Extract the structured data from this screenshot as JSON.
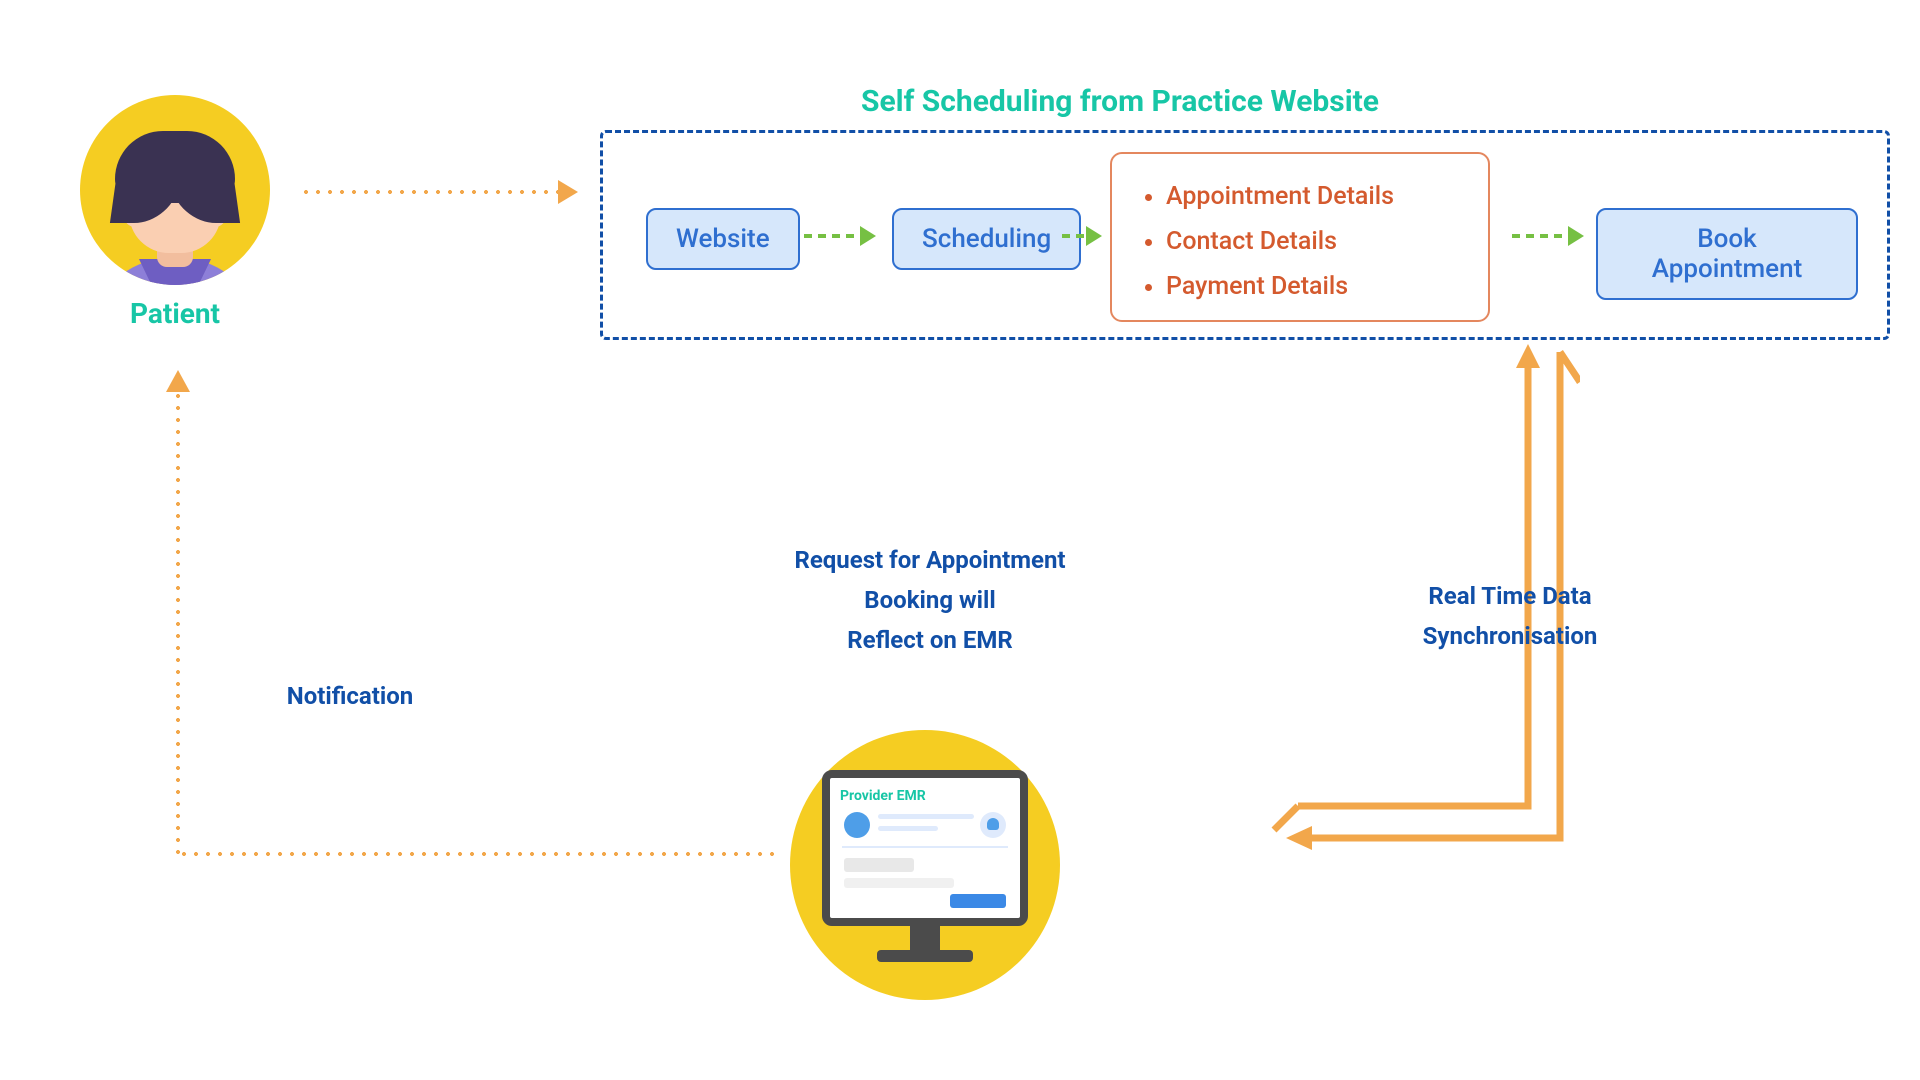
{
  "diagram": {
    "patient_label": "Patient",
    "container_title": "Self Scheduling from Practice Website",
    "nodes": {
      "website": "Website",
      "scheduling": "Scheduling",
      "book_appointment": "Book Appointment"
    },
    "details": {
      "item1": "Appointment Details",
      "item2": "Contact Details",
      "item3": "Payment Details"
    },
    "emr": {
      "badge": "Provider EMR",
      "request_line1": "Request for Appointment",
      "request_line2": "Booking will",
      "request_line3": "Reflect on EMR"
    },
    "sync_line1": "Real Time Data",
    "sync_line2": "Synchronisation",
    "notification_label": "Notification"
  }
}
